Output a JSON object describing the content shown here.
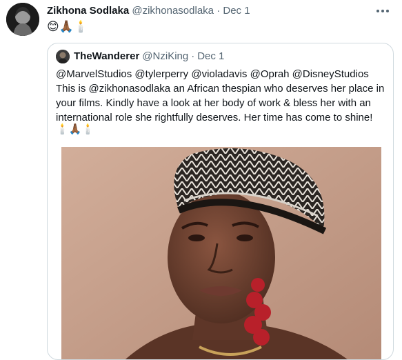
{
  "tweet": {
    "author_name": "Zikhona Sodlaka",
    "handle": "@zikhonasodlaka",
    "separator": "·",
    "date": "Dec 1",
    "text": "😊🙏🏾🕯️",
    "more_icon": "more-horizontal-icon"
  },
  "quote": {
    "author_name": "TheWanderer",
    "handle": "@NziKing",
    "separator": "·",
    "date": "Dec 1",
    "text": "@MarvelStudios @tylerperry @violadavis @Oprah @DisneyStudios This is @zikhonasodlaka an African thespian who deserves her place in your films. Kindly have a look at her body of work & bless her with an international role she rightfully deserves. Her time has come to shine!",
    "emoji_line": "🕯️🙏🏾🕯️"
  },
  "colors": {
    "text": "#0f1419",
    "muted": "#536471",
    "border": "#cfd9de",
    "photo_background": "#c7a08c"
  }
}
